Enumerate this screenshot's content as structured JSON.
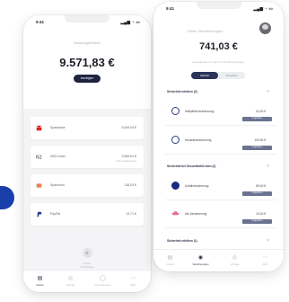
{
  "left_phone": {
    "status_time": "9:41",
    "status_icons": "▂▄▆ ◔ ▭",
    "balance_label": "Gesamtguthaben",
    "balance_amount": "9.571,83 €",
    "balance_button": "Anzeigen",
    "accounts": [
      {
        "name": "Sparkasse",
        "amount": "5.549,93 €",
        "sub": "",
        "icon": "sparkasse-icon",
        "color": "#e2231a"
      },
      {
        "name": "N26 Konto",
        "amount": "3.869,61 €",
        "sub": "Letzte Aktualisierung",
        "icon": "n26-icon",
        "color": "#36a18b"
      },
      {
        "name": "Sparkonto",
        "amount": "138,63 €",
        "sub": "",
        "icon": "bank-icon",
        "color": "#e8804c"
      },
      {
        "name": "PayPal",
        "amount": "13,71 €",
        "sub": "",
        "icon": "paypal-icon",
        "color": "#1f3c88"
      }
    ],
    "add_label": "Konto hinzufügen",
    "tabs": [
      {
        "label": "Konten",
        "icon": "accounts-icon",
        "glyph": "▤"
      },
      {
        "label": "Verträge",
        "icon": "contracts-icon",
        "glyph": "◎"
      },
      {
        "label": "Versicherungen",
        "icon": "insurance-icon",
        "glyph": "◯"
      },
      {
        "label": "Mehr",
        "icon": "more-icon",
        "glyph": "⋯"
      }
    ]
  },
  "right_phone": {
    "status_time": "9:41",
    "status_icons": "▂▄▆ ◔ ▭",
    "user_label": "Deine Versicherungen",
    "amount": "741,03 €",
    "subtitle": "Gesamtkosten pro Jahr für alle Versicherungen",
    "segments": [
      "Jährlich",
      "Monatlich"
    ],
    "sections": [
      {
        "title": "Sicherheit erhöhen (2)",
        "close": "×"
      },
      {
        "title": "Sicherheit bei Gesundheit/Leben (2)",
        "close": "×"
      },
      {
        "title": "Sicherheit erhöhen (1)",
        "close": "×"
      }
    ],
    "items": [
      {
        "name": "Haftpflichtversicherung",
        "value": "61,90 €",
        "button": "Vergleichen",
        "icon": "shield-icon"
      },
      {
        "name": "Hausratversicherung",
        "value": "109,00 €",
        "button": "Vergleichen",
        "icon": "home-icon"
      },
      {
        "name": "Unfallversicherung",
        "value": "89,00 €",
        "button": "Vergleichen",
        "icon": "accident-icon"
      },
      {
        "name": "Kfz-Versicherung",
        "value": "24,00 €",
        "button": "Vergleichen",
        "icon": "car-icon"
      }
    ],
    "tabs": [
      {
        "label": "Konten",
        "icon": "accounts-icon",
        "glyph": "▤"
      },
      {
        "label": "Versicherungen",
        "icon": "insurance-icon",
        "glyph": "◉"
      },
      {
        "label": "Verträge",
        "icon": "contracts-icon",
        "glyph": "◎"
      },
      {
        "label": "Mehr",
        "icon": "more-icon",
        "glyph": "⋯"
      }
    ]
  }
}
